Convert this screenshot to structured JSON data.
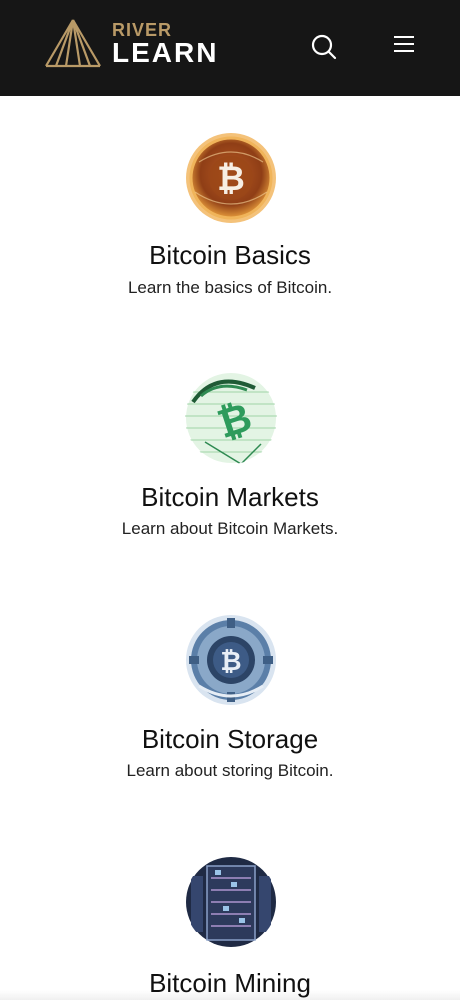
{
  "header": {
    "logo_top": "RIVER",
    "logo_bottom": "LEARN",
    "search_icon": "search-icon",
    "menu_icon": "hamburger-menu-icon"
  },
  "colors": {
    "header_bg": "#161616",
    "logo_gold": "#b99a67",
    "text": "#111111"
  },
  "cards": [
    {
      "title": "Bitcoin Basics",
      "desc": "Learn the basics of Bitcoin.",
      "icon": "bitcoin-basics-icon"
    },
    {
      "title": "Bitcoin Markets",
      "desc": "Learn about Bitcoin Markets.",
      "icon": "bitcoin-markets-icon"
    },
    {
      "title": "Bitcoin Storage",
      "desc": "Learn about storing Bitcoin.",
      "icon": "bitcoin-storage-icon"
    },
    {
      "title": "Bitcoin Mining",
      "desc": "",
      "icon": "bitcoin-mining-icon"
    }
  ]
}
